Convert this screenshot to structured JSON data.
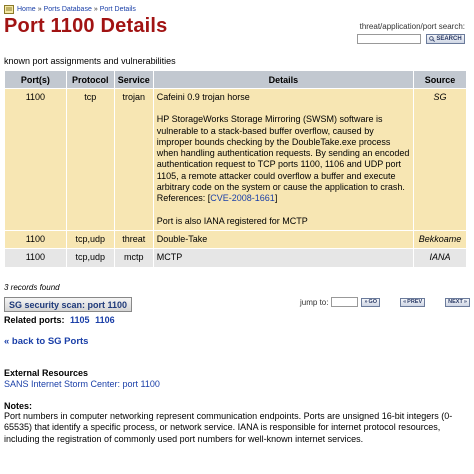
{
  "breadcrumb": {
    "home": "Home",
    "sep1": "»",
    "ports_db": "Ports Database",
    "sep2": "»",
    "current": "Port Details"
  },
  "page_title": "Port 1100 Details",
  "search": {
    "label": "threat/application/port search:",
    "value": "",
    "button": "SEARCH"
  },
  "subtitle": "known port assignments and vulnerabilities",
  "table": {
    "headers": [
      "Port(s)",
      "Protocol",
      "Service",
      "Details",
      "Source"
    ],
    "rows": [
      {
        "port": "1100",
        "protocol": "tcp",
        "service": "trojan",
        "details": {
          "p1": "Cafeini 0.9 trojan horse",
          "p2": "HP StorageWorks Storage Mirroring (SWSM) software is vulnerable to a stack-based buffer overflow, caused by improper bounds checking by the DoubleTake.exe process when handling authentication requests. By sending an encoded authentication request to TCP ports 1100, 1106 and UDP port 1105, a remote attacker could overflow a buffer and execute arbitrary code on the system or cause the application to crash.",
          "ref_prefix": "References: [",
          "ref_link": "CVE-2008-1661",
          "ref_suffix": "]",
          "p3": "Port is also IANA registered for MCTP"
        },
        "source": "SG"
      },
      {
        "port": "1100",
        "protocol": "tcp,udp",
        "service": "threat",
        "details_text": "Double-Take",
        "source": "Bekkoame"
      },
      {
        "port": "1100",
        "protocol": "tcp,udp",
        "service": "mctp",
        "details_text": "MCTP",
        "source": "IANA"
      }
    ]
  },
  "records_found": "3 records found",
  "scan_button": "SG security scan: port 1100",
  "jump": {
    "label": "jump to:",
    "go": "GO",
    "prev": "PREV",
    "next": "NEXT"
  },
  "related": {
    "label": "Related ports:",
    "ports": [
      "1105",
      "1106"
    ]
  },
  "back_link": "« back to SG Ports",
  "external": {
    "heading": "External Resources",
    "link": "SANS Internet Storm Center: port 1100"
  },
  "notes": {
    "heading": "Notes:",
    "text": "Port numbers in computer networking represent communication endpoints. Ports are unsigned 16-bit integers (0-65535) that identify a specific process, or network service. IANA is responsible for internet protocol resources, including the registration of commonly used port numbers for well-known internet services."
  },
  "colors": {
    "title": "#a11313",
    "link": "#1a3fa8",
    "header_bg": "#c2c8d0",
    "row_sg": "#f7e6b3",
    "row_iana": "#e6e6e6"
  },
  "icons": {
    "home": "home-icon",
    "search": "search-icon",
    "go": "go-arrow-icon",
    "prev": "prev-arrow-icon",
    "next": "next-arrow-icon"
  }
}
